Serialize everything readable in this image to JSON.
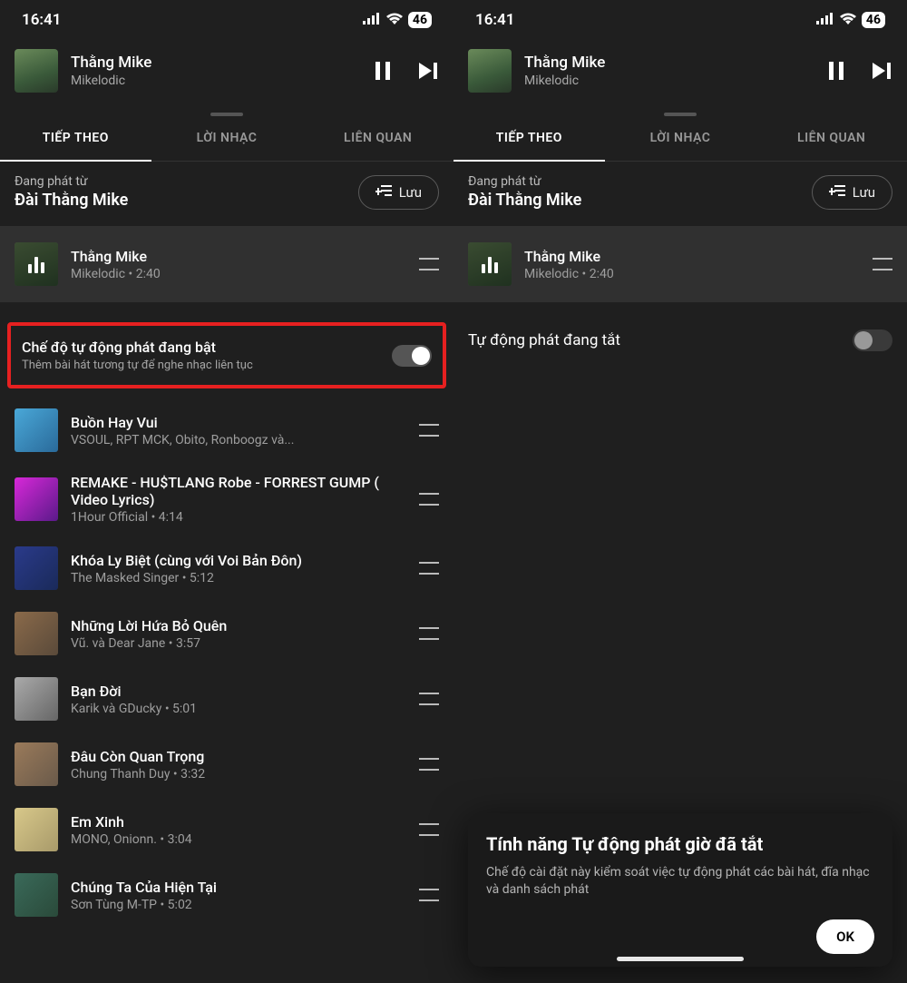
{
  "statusbar": {
    "time": "16:41",
    "battery": "46"
  },
  "now_playing": {
    "title": "Thằng Mike",
    "artist": "Mikelodic"
  },
  "tabs": {
    "next": "TIẾP THEO",
    "lyrics": "LỜI NHẠC",
    "related": "LIÊN QUAN"
  },
  "context": {
    "label": "Đang phát từ",
    "source": "Đài Thằng Mike",
    "save": "Lưu"
  },
  "current_track": {
    "title": "Thằng Mike",
    "meta": "Mikelodic • 2:40"
  },
  "autoplay_on": {
    "title": "Chế độ tự động phát đang bật",
    "subtitle": "Thêm bài hát tương tự để nghe nhạc liên tục"
  },
  "autoplay_off": {
    "title": "Tự động phát đang tắt"
  },
  "dialog": {
    "title": "Tính năng Tự động phát giờ đã tắt",
    "body": "Chế độ cài đặt này kiểm soát việc tự động phát các bài hát, đĩa nhạc và danh sách phát",
    "ok": "OK"
  },
  "queue": [
    {
      "title": "Buồn Hay Vui",
      "meta": "VSOUL, RPT MCK, Obito, Ronboogz và..."
    },
    {
      "title": "REMAKE - HU$TLANG Robe - FORREST GUMP ( Video Lyrics)",
      "meta": "1Hour Official • 4:14"
    },
    {
      "title": "Khóa Ly Biệt (cùng với Voi Bản Đôn)",
      "meta": "The Masked Singer • 5:12"
    },
    {
      "title": "Những Lời Hứa Bỏ Quên",
      "meta": "Vũ. và Dear Jane • 3:57"
    },
    {
      "title": "Bạn Đời",
      "meta": "Karik và GDucky • 5:01"
    },
    {
      "title": "Đâu Còn Quan Trọng",
      "meta": "Chung Thanh Duy • 3:32"
    },
    {
      "title": "Em Xinh",
      "meta": "MONO, Onionn. • 3:04"
    },
    {
      "title": "Chúng Ta Của Hiện Tại",
      "meta": "Sơn Tùng M-TP • 5:02"
    }
  ]
}
